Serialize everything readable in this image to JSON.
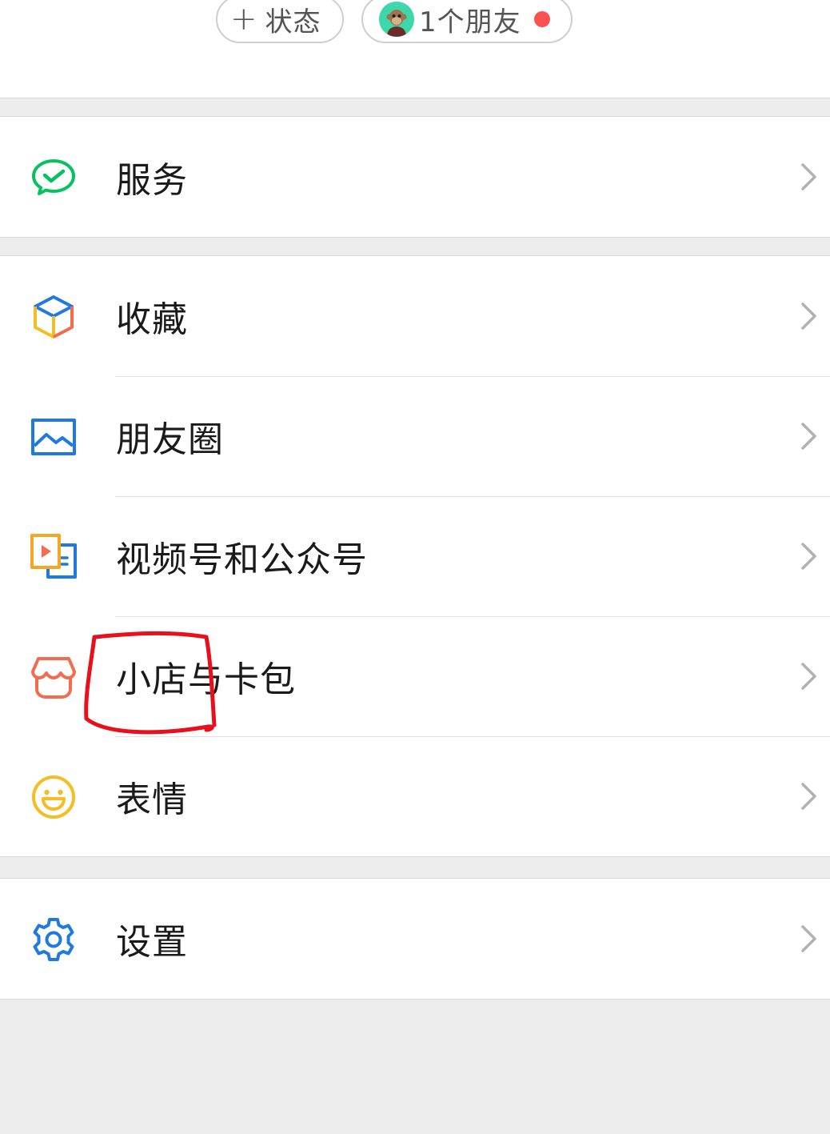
{
  "header": {
    "status_pill": {
      "icon": "plus-icon",
      "label": "状态"
    },
    "friends_pill": {
      "icon": "avatar",
      "label": "1个朋友",
      "badge_color": "#fa5151"
    }
  },
  "menu": {
    "services": {
      "label": "服务",
      "icon": "wechat-pay-check-icon",
      "color": "#07c160"
    },
    "favorites": {
      "label": "收藏",
      "icon": "cube-icon"
    },
    "moments": {
      "label": "朋友圈",
      "icon": "picture-icon",
      "color": "#1f7ae0"
    },
    "channels": {
      "label": "视频号和公众号",
      "icon": "channels-icon"
    },
    "shop": {
      "label": "小店与卡包",
      "icon": "shop-icon",
      "color": "#f26c4f"
    },
    "stickers": {
      "label": "表情",
      "icon": "smiley-icon",
      "color": "#f5bd1f"
    },
    "settings": {
      "label": "设置",
      "icon": "gear-icon",
      "color": "#1f7ae0"
    }
  },
  "annotation_color": "#e8101a"
}
